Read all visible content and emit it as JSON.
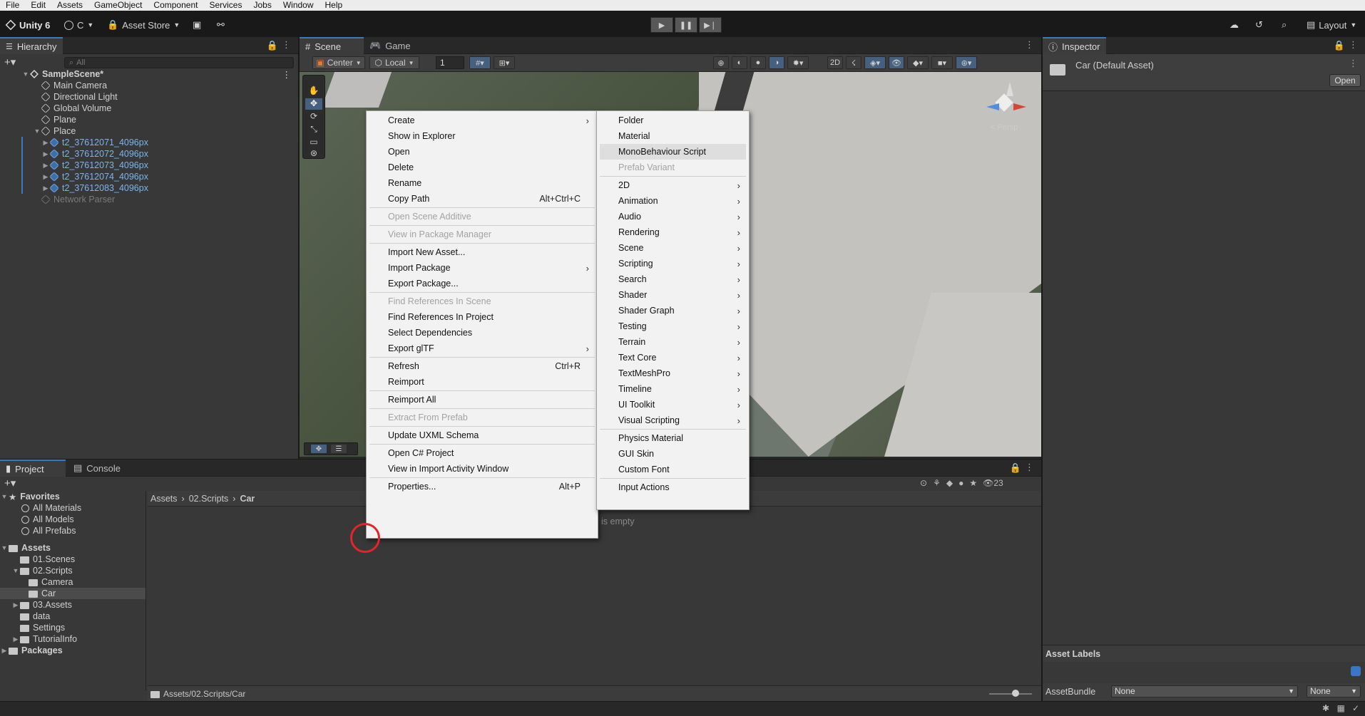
{
  "menubar": [
    "File",
    "Edit",
    "Assets",
    "GameObject",
    "Component",
    "Services",
    "Jobs",
    "Window",
    "Help"
  ],
  "toolbar": {
    "unity_label": "Unity 6",
    "account_label": "C",
    "asset_store_label": "Asset Store",
    "layout_label": "Layout"
  },
  "hierarchy": {
    "tab": "Hierarchy",
    "search_placeholder": "All",
    "scene_name": "SampleScene*",
    "items": [
      "Main Camera",
      "Directional Light",
      "Global Volume",
      "Plane",
      "Place"
    ],
    "place_children": [
      "t2_37612071_4096px",
      "t2_37612072_4096px",
      "t2_37612073_4096px",
      "t2_37612074_4096px",
      "t2_37612083_4096px"
    ],
    "disabled_item": "Network Parser"
  },
  "scene_tabs": {
    "scene": "Scene",
    "game": "Game"
  },
  "scene_toolbar": {
    "pivot": "Center",
    "space": "Local",
    "grid_value": "1",
    "persp_label": "< Persp"
  },
  "inspector": {
    "tab": "Inspector",
    "asset_title": "Car (Default Asset)",
    "open_button": "Open",
    "asset_labels": "Asset Labels",
    "asset_bundle_label": "AssetBundle",
    "bundle_value": "None",
    "variant_value": "None"
  },
  "bottom_tabs": {
    "project": "Project",
    "console": "Console"
  },
  "project": {
    "favorites_label": "Favorites",
    "favorites": [
      "All Materials",
      "All Models",
      "All Prefabs"
    ],
    "assets_label": "Assets",
    "assets": [
      "01.Scenes",
      "02.Scripts",
      "Camera",
      "Car",
      "03.Assets",
      "data",
      "Settings",
      "TutorialInfo"
    ],
    "packages_label": "Packages",
    "breadcrumb": [
      "Assets",
      "02.Scripts",
      "Car"
    ],
    "empty_text": "is empty",
    "status_path": "Assets/02.Scripts/Car",
    "hidden_count": "23"
  },
  "context_menu": {
    "items": [
      {
        "label": "Create",
        "submenu": true
      },
      {
        "label": "Show in Explorer"
      },
      {
        "label": "Open"
      },
      {
        "label": "Delete"
      },
      {
        "label": "Rename"
      },
      {
        "label": "Copy Path",
        "shortcut": "Alt+Ctrl+C"
      },
      {
        "label": "Open Scene Additive",
        "disabled": true
      },
      {
        "label": "View in Package Manager",
        "disabled": true
      },
      {
        "label": "Import New Asset..."
      },
      {
        "label": "Import Package",
        "submenu": true
      },
      {
        "label": "Export Package..."
      },
      {
        "label": "Find References In Scene",
        "disabled": true
      },
      {
        "label": "Find References In Project"
      },
      {
        "label": "Select Dependencies"
      },
      {
        "label": "Export glTF",
        "submenu": true
      },
      {
        "label": "Refresh",
        "shortcut": "Ctrl+R"
      },
      {
        "label": "Reimport"
      },
      {
        "label": "Reimport All"
      },
      {
        "label": "Extract From Prefab",
        "disabled": true
      },
      {
        "label": "Update UXML Schema"
      },
      {
        "label": "Open C# Project"
      },
      {
        "label": "View in Import Activity Window"
      },
      {
        "label": "Properties...",
        "shortcut": "Alt+P"
      }
    ]
  },
  "create_submenu": {
    "items": [
      {
        "label": "Folder"
      },
      {
        "label": "Material"
      },
      {
        "label": "MonoBehaviour Script",
        "highlighted": true
      },
      {
        "label": "Prefab Variant",
        "disabled": true
      },
      {
        "label": "2D",
        "submenu": true
      },
      {
        "label": "Animation",
        "submenu": true
      },
      {
        "label": "Audio",
        "submenu": true
      },
      {
        "label": "Rendering",
        "submenu": true
      },
      {
        "label": "Scene",
        "submenu": true
      },
      {
        "label": "Scripting",
        "submenu": true
      },
      {
        "label": "Search",
        "submenu": true
      },
      {
        "label": "Shader",
        "submenu": true
      },
      {
        "label": "Shader Graph",
        "submenu": true
      },
      {
        "label": "Testing",
        "submenu": true
      },
      {
        "label": "Terrain",
        "submenu": true
      },
      {
        "label": "Text Core",
        "submenu": true
      },
      {
        "label": "TextMeshPro",
        "submenu": true
      },
      {
        "label": "Timeline",
        "submenu": true
      },
      {
        "label": "UI Toolkit",
        "submenu": true
      },
      {
        "label": "Visual Scripting",
        "submenu": true
      },
      {
        "label": "Physics Material"
      },
      {
        "label": "GUI Skin"
      },
      {
        "label": "Custom Font"
      },
      {
        "label": "Input Actions"
      }
    ]
  },
  "colors": {
    "accent": "#3a79bb",
    "prefab_text": "#7cb3f0",
    "cursor_ring": "#e0262b"
  }
}
